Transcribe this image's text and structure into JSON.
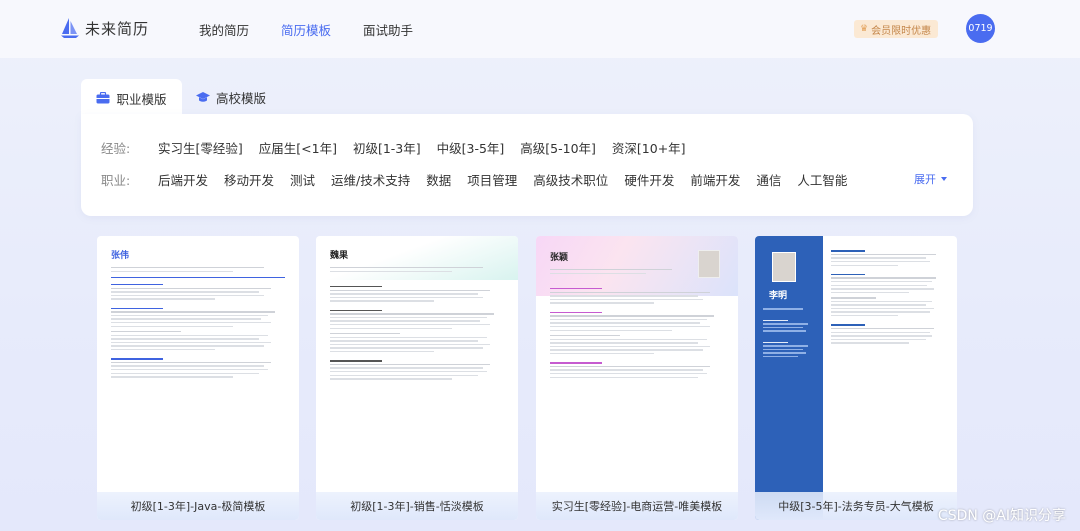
{
  "header": {
    "logo_text": "未来简历",
    "nav": [
      "我的简历",
      "简历模板",
      "面试助手"
    ],
    "active_nav": 1,
    "vip_label": "会员限时优惠",
    "avatar_text": "0719"
  },
  "tabs": {
    "active": "职业模版",
    "other": "高校模版"
  },
  "filters": {
    "experience_label": "经验:",
    "experience_options": [
      "实习生[零经验]",
      "应届生[<1年]",
      "初级[1-3年]",
      "中级[3-5年]",
      "高级[5-10年]",
      "资深[10+年]"
    ],
    "job_label": "职业:",
    "job_options": [
      "后端开发",
      "移动开发",
      "测试",
      "运维/技术支持",
      "数据",
      "项目管理",
      "高级技术职位",
      "硬件开发",
      "前端开发",
      "通信",
      "人工智能"
    ],
    "expand_label": "展开"
  },
  "cards": [
    {
      "name": "张伟",
      "caption": "初级[1-3年]-Java-极简模板",
      "accent": "#3f63e0"
    },
    {
      "name": "魏果",
      "caption": "初级[1-3年]-销售-恬淡模板",
      "accent": "#222222"
    },
    {
      "name": "张颖",
      "caption": "实习生[零经验]-电商运营-唯美模板",
      "accent": "#c65bd0"
    },
    {
      "name": "李明",
      "caption": "中级[3-5年]-法务专员-大气模板",
      "accent": "#2d61b8"
    }
  ],
  "watermark": "CSDN @AI知识分享",
  "colors": {
    "primary": "#4a6cf0",
    "vip_bg": "#fbe9d4",
    "vip_text": "#c4864a"
  }
}
